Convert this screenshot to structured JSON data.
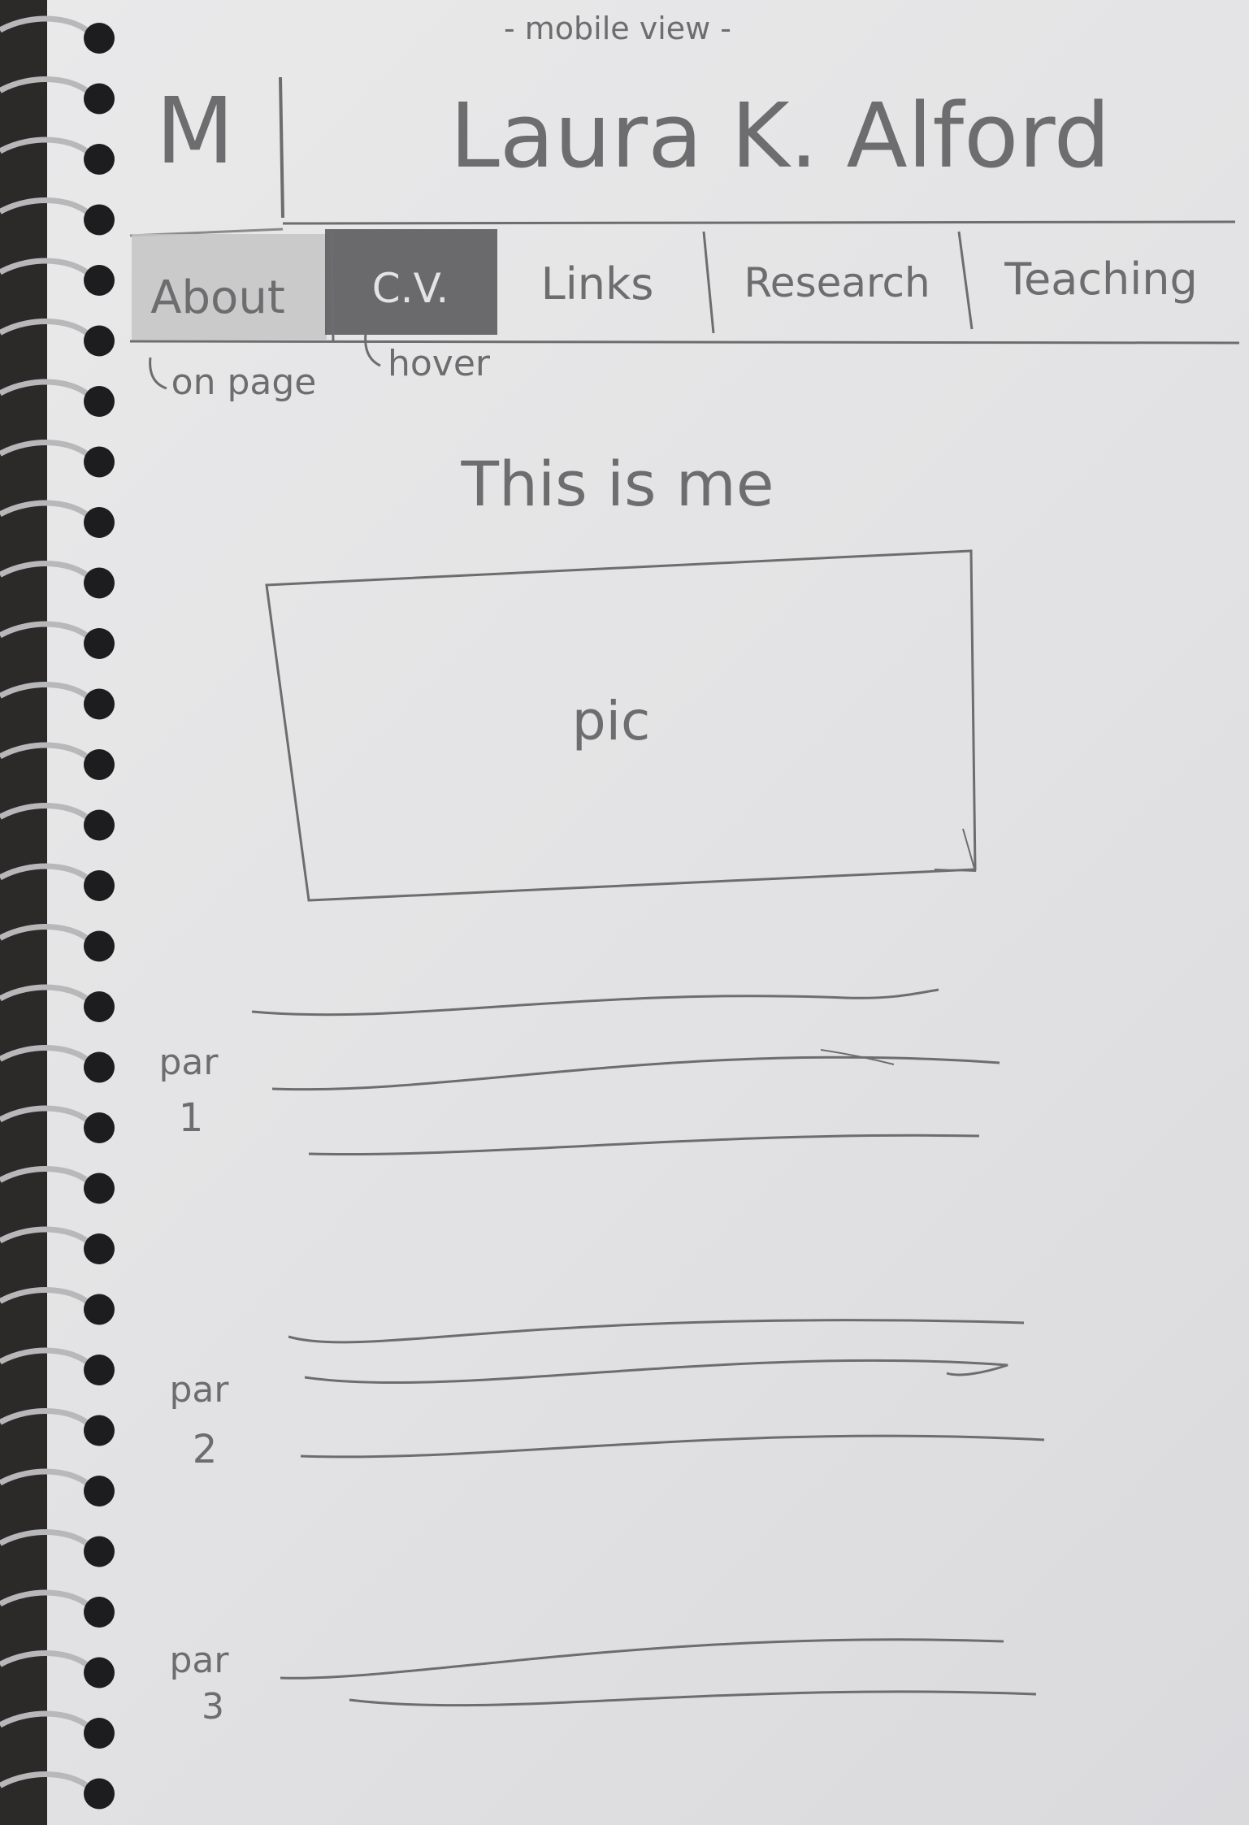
{
  "view_label": "- mobile view -",
  "header": {
    "logo": "M",
    "name": "Laura K. Alford"
  },
  "nav": {
    "items": [
      {
        "label": "About",
        "state": "current"
      },
      {
        "label": "C.V.",
        "state": "hover"
      },
      {
        "label": "Links",
        "state": "normal"
      },
      {
        "label": "Research",
        "state": "normal"
      },
      {
        "label": "Teaching",
        "state": "normal"
      }
    ]
  },
  "annotations": {
    "on_page": "on page",
    "hover": "hover"
  },
  "main": {
    "heading": "This is me",
    "photo_label": "pic",
    "paragraphs": [
      {
        "label_line1": "par",
        "label_line2": "1"
      },
      {
        "label_line1": "par",
        "label_line2": "2"
      },
      {
        "label_line1": "par",
        "label_line2": "3"
      }
    ]
  },
  "colors": {
    "paper": "#e6e6e8",
    "pencil": "#6d6d70",
    "hover_fill": "#5c5c5f",
    "current_fill": "#c4c4c6",
    "spiral": "#1d1d1f"
  }
}
